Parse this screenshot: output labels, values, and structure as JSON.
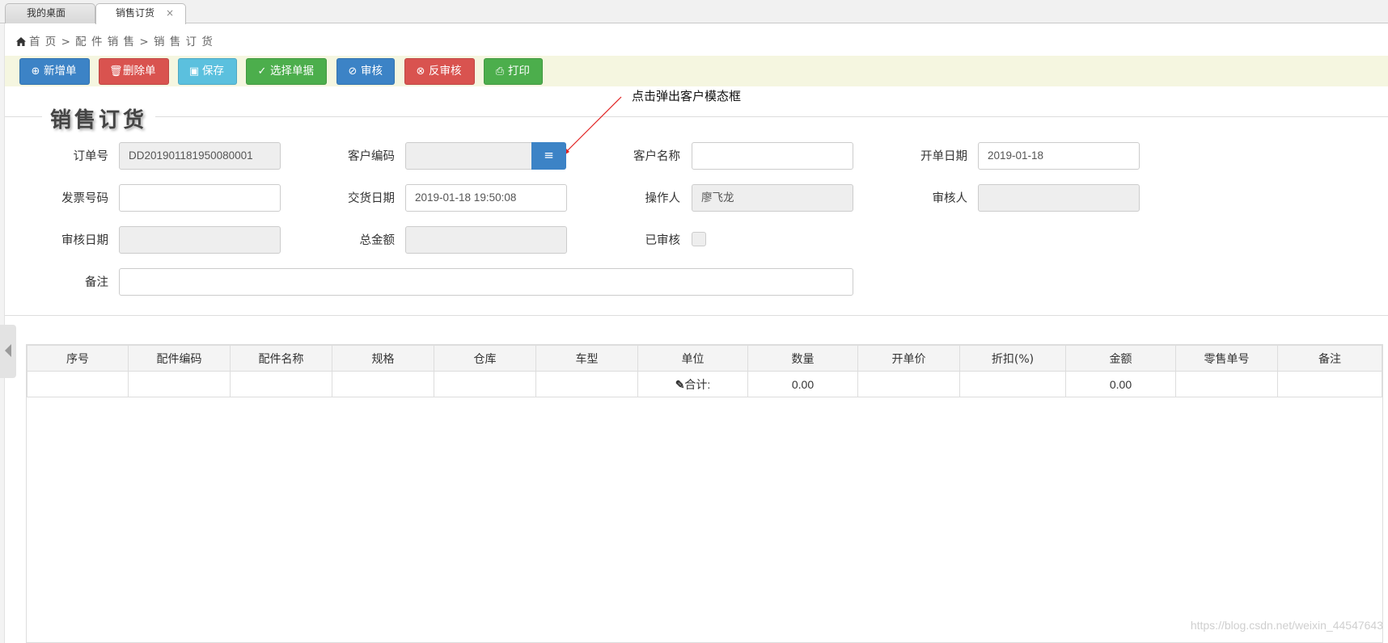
{
  "tabs": [
    {
      "label": "我的桌面"
    },
    {
      "label": "销售订货",
      "close": "×"
    }
  ],
  "breadcrumb": "首 页 > 配 件 销 售 > 销 售 订 货",
  "toolbar": {
    "new": "新增单",
    "delete": "删除单",
    "save": "保存",
    "select": "选择单据",
    "audit": "审核",
    "unaudit": "反审核",
    "print": "打印"
  },
  "section_title": "销售订货",
  "annotation": "点击弹出客户模态框",
  "form": {
    "order_no_label": "订单号",
    "order_no": "DD201901181950080001",
    "customer_code_label": "客户编码",
    "customer_code": "",
    "customer_name_label": "客户名称",
    "customer_name": "",
    "open_date_label": "开单日期",
    "open_date": "2019-01-18",
    "invoice_label": "发票号码",
    "invoice": "",
    "delivery_label": "交货日期",
    "delivery": "2019-01-18 19:50:08",
    "operator_label": "操作人",
    "operator": "廖飞龙",
    "auditor_label": "审核人",
    "auditor": "",
    "audit_date_label": "审核日期",
    "audit_date": "",
    "total_label": "总金额",
    "total": "",
    "audited_label": "已审核",
    "audited": false,
    "remark_label": "备注",
    "remark": ""
  },
  "table": {
    "headers": [
      "序号",
      "配件编码",
      "配件名称",
      "规格",
      "仓库",
      "车型",
      "单位",
      "数量",
      "开单价",
      "折扣(%)",
      "金额",
      "零售单号",
      "备注"
    ],
    "summary": {
      "label": "合计:",
      "qty": "0.00",
      "amount": "0.00"
    }
  },
  "watermark": "https://blog.csdn.net/weixin_44547643",
  "colors": {
    "primary": "#3c83c6",
    "danger": "#d9534f",
    "info": "#5bc0de",
    "success": "#4cae4c"
  }
}
